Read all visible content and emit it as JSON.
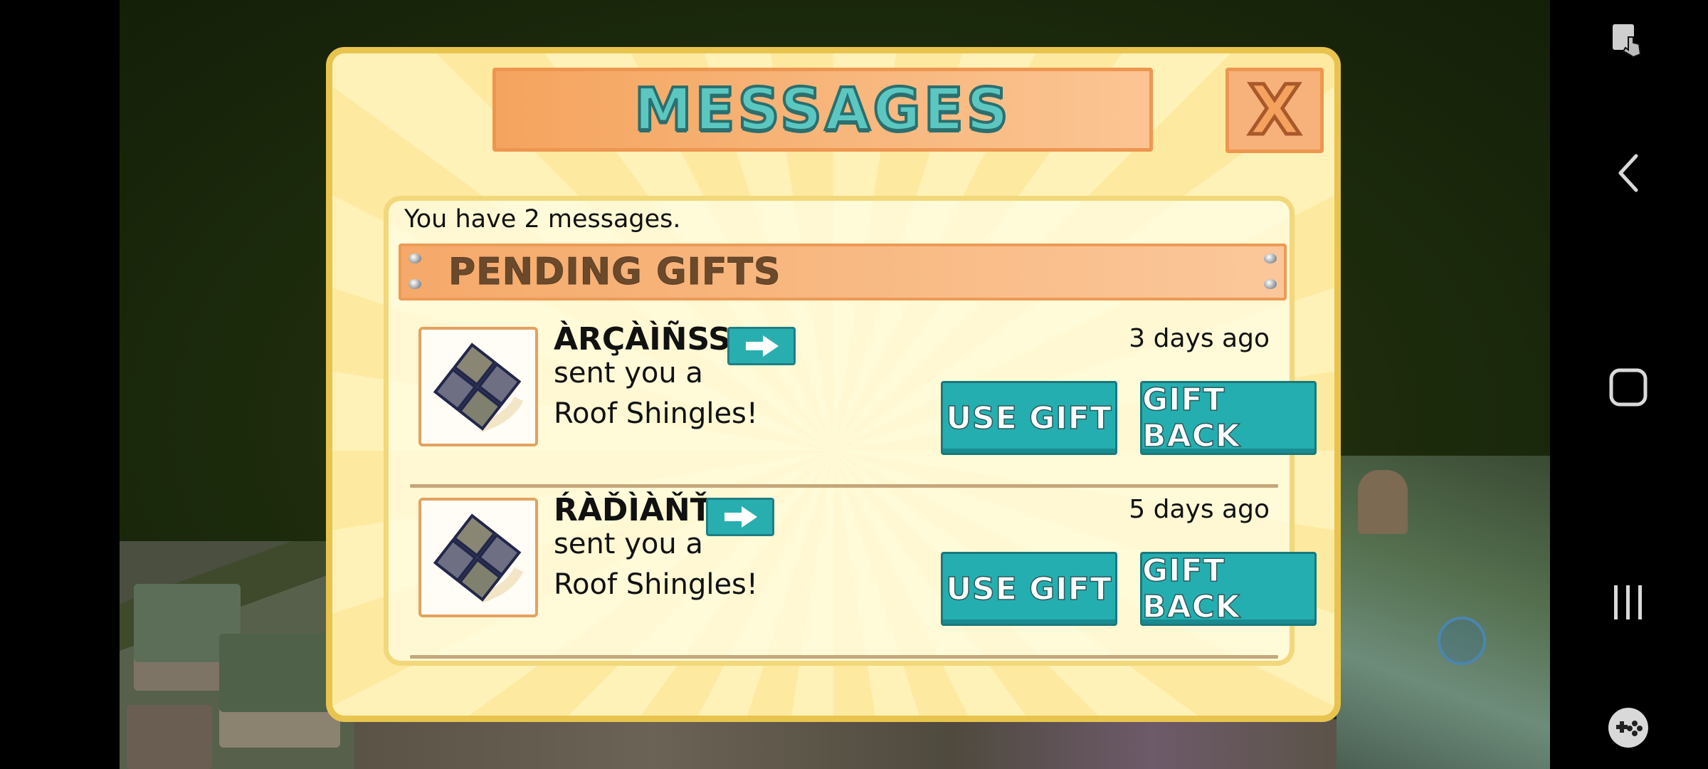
{
  "dialog": {
    "title": "MESSAGES",
    "close_label": "X",
    "count_text": "You have 2 messages.",
    "section_title": "PENDING GIFTS"
  },
  "messages": [
    {
      "sender": "ÀRÇÀÌÑSS",
      "line1": "sent you a",
      "line2": "Roof Shingles!",
      "time": "3 days ago",
      "use_label": "USE GIFT",
      "back_label": "GIFT BACK",
      "gift_icon": "roof-shingles-icon"
    },
    {
      "sender": "ŔÀĎÌÀŇŤ",
      "line1": "sent you a",
      "line2": "Roof Shingles!",
      "time": "5 days ago",
      "use_label": "USE GIFT",
      "back_label": "GIFT BACK",
      "gift_icon": "roof-shingles-icon"
    }
  ],
  "nav_bar": {
    "icons": [
      "screen-touch-icon",
      "back-icon",
      "home-icon",
      "recents-icon",
      "game-launcher-icon"
    ]
  },
  "colors": {
    "accent_teal": "#25aeb0",
    "banner_orange": "#f5a45e",
    "dialog_border": "#e8c44e"
  }
}
